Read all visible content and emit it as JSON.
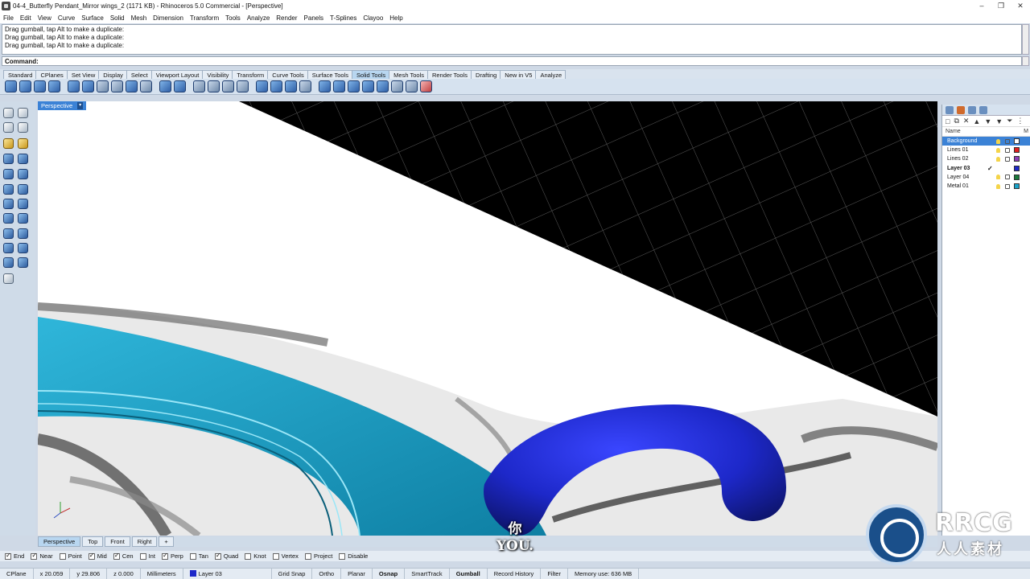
{
  "window": {
    "title": "04-4_Butterfly Pendant_Mirror wings_2 (1171 KB) - Rhinoceros 5.0 Commercial - [Perspective]",
    "buttons": [
      "–",
      "❐",
      "✕"
    ]
  },
  "menu": [
    "File",
    "Edit",
    "View",
    "Curve",
    "Surface",
    "Solid",
    "Mesh",
    "Dimension",
    "Transform",
    "Tools",
    "Analyze",
    "Render",
    "Panels",
    "T-Splines",
    "Clayoo",
    "Help"
  ],
  "history": [
    "Drag gumball, tap Alt to make a duplicate:",
    "Drag gumball, tap Alt to make a duplicate:",
    "Drag gumball, tap Alt to make a duplicate:"
  ],
  "command": {
    "label": "Command:",
    "value": ""
  },
  "toolbar_tabs": [
    "Standard",
    "CPlanes",
    "Set View",
    "Display",
    "Select",
    "Viewport Layout",
    "Visibility",
    "Transform",
    "Curve Tools",
    "Surface Tools",
    "Solid Tools",
    "Mesh Tools",
    "Render Tools",
    "Drafting",
    "New in V5",
    "Analyze"
  ],
  "active_toolbar_tab": "Solid Tools",
  "viewport": {
    "label": "Perspective",
    "caret": "▾",
    "colors": {
      "background": "#ffffff",
      "grid": "#000000",
      "teal": "#1aa3c9",
      "blue_torus": "#1d28c9"
    }
  },
  "subtitle": {
    "zh": "你",
    "en": "YOU."
  },
  "layers_panel": {
    "header": "Name",
    "header_right": "M",
    "tools": [
      "□",
      "⧉",
      "✕",
      "▲",
      "▼",
      "▼",
      "⏷",
      "⋮"
    ],
    "layers": [
      {
        "name": "Background",
        "color": "#ffffff",
        "selected": true,
        "current": false,
        "check": ""
      },
      {
        "name": "Lines 01",
        "color": "#e02020",
        "selected": false,
        "current": false,
        "check": ""
      },
      {
        "name": "Lines 02",
        "color": "#8a3fb8",
        "selected": false,
        "current": false,
        "check": ""
      },
      {
        "name": "Layer 03",
        "color": "#1d28c9",
        "selected": false,
        "current": true,
        "check": "✓"
      },
      {
        "name": "Layer 04",
        "color": "#1a7a3a",
        "selected": false,
        "current": false,
        "check": ""
      },
      {
        "name": "Metal 01",
        "color": "#1aa3c9",
        "selected": false,
        "current": false,
        "check": ""
      }
    ]
  },
  "viewport_tabs": [
    "Perspective",
    "Top",
    "Front",
    "Right",
    "+"
  ],
  "active_viewport_tab": "Perspective",
  "osnaps": [
    {
      "label": "End",
      "on": true
    },
    {
      "label": "Near",
      "on": true
    },
    {
      "label": "Point",
      "on": false
    },
    {
      "label": "Mid",
      "on": true
    },
    {
      "label": "Cen",
      "on": true
    },
    {
      "label": "Int",
      "on": false
    },
    {
      "label": "Perp",
      "on": true
    },
    {
      "label": "Tan",
      "on": false
    },
    {
      "label": "Quad",
      "on": true
    },
    {
      "label": "Knot",
      "on": false
    },
    {
      "label": "Vertex",
      "on": false
    },
    {
      "label": "Project",
      "on": false
    },
    {
      "label": "Disable",
      "on": false
    }
  ],
  "status": {
    "cplane": "CPlane",
    "x": "x 20.059",
    "y": "y 29.806",
    "z": "z 0.000",
    "units": "Millimeters",
    "layer": "Layer 03",
    "layer_color": "#1d28c9",
    "grid_snap": "Grid Snap",
    "ortho": "Ortho",
    "planar": "Planar",
    "osnap": "Osnap",
    "smarttrack": "SmartTrack",
    "gumball": "Gumball",
    "record_history": "Record History",
    "filter": "Filter",
    "memory": "Memory use: 636 MB"
  },
  "logo": {
    "text": "RRCG",
    "zh": "人人素材"
  }
}
